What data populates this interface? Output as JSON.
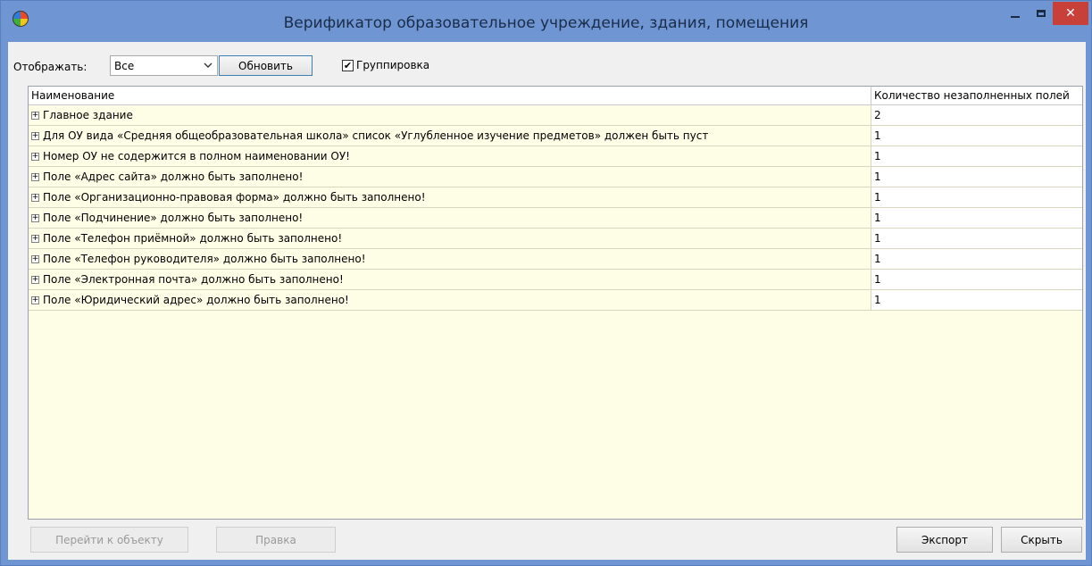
{
  "window": {
    "title": "Верификатор образовательное учреждение, здания, помещения",
    "close_glyph": "✕"
  },
  "toolbar": {
    "display_label": "Отображать:",
    "display_value": "Все",
    "refresh_label": "Обновить",
    "grouping_label": "Группировка",
    "grouping_checked": true,
    "check_glyph": "✔"
  },
  "grid": {
    "columns": [
      "Наименование",
      "Количество незаполненных полей"
    ],
    "expander_glyph": "+",
    "rows": [
      {
        "name": "Главное здание",
        "count": "2"
      },
      {
        "name": "Для ОУ вида «Средняя общеобразовательная школа» список «Углубленное изучение предметов» должен быть пуст",
        "count": "1"
      },
      {
        "name": "Номер ОУ не содержится в полном наименовании ОУ!",
        "count": "1"
      },
      {
        "name": "Поле «Адрес сайта» должно быть заполнено!",
        "count": "1"
      },
      {
        "name": "Поле «Организационно-правовая форма» должно быть заполнено!",
        "count": "1"
      },
      {
        "name": "Поле «Подчинение» должно быть заполнено!",
        "count": "1"
      },
      {
        "name": "Поле «Телефон приёмной» должно быть заполнено!",
        "count": "1"
      },
      {
        "name": "Поле «Телефон руководителя» должно быть заполнено!",
        "count": "1"
      },
      {
        "name": "Поле «Электронная почта» должно быть заполнено!",
        "count": "1"
      },
      {
        "name": "Поле «Юридический адрес» должно быть заполнено!",
        "count": "1"
      }
    ]
  },
  "footer": {
    "goto_label": "Перейти к объекту",
    "edit_label": "Правка",
    "export_label": "Экспорт",
    "hide_label": "Скрыть"
  }
}
